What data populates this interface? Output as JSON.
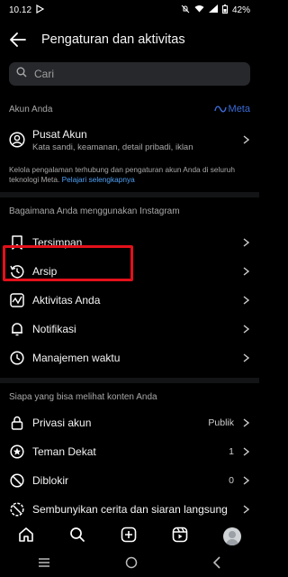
{
  "status": {
    "time": "10.12",
    "battery": "42%"
  },
  "header": {
    "title": "Pengaturan dan aktivitas"
  },
  "search": {
    "placeholder": "Cari"
  },
  "account": {
    "section_title": "Akun Anda",
    "meta_logo": "Meta",
    "item_label": "Pusat Akun",
    "item_sub": "Kata sandi, keamanan, detail pribadi, iklan",
    "note": "Kelola pengalaman terhubung dan pengaturan akun Anda di seluruh teknologi Meta.",
    "note_link": "Pelajari selengkapnya"
  },
  "usage": {
    "section_title": "Bagaimana Anda menggunakan Instagram",
    "items": [
      {
        "label": "Tersimpan",
        "icon": "bookmark-icon"
      },
      {
        "label": "Arsip",
        "icon": "archive-history-icon"
      },
      {
        "label": "Aktivitas Anda",
        "icon": "activity-icon"
      },
      {
        "label": "Notifikasi",
        "icon": "bell-icon"
      },
      {
        "label": "Manajemen waktu",
        "icon": "clock-icon"
      }
    ]
  },
  "visibility": {
    "section_title": "Siapa yang bisa melihat konten Anda",
    "items": [
      {
        "label": "Privasi akun",
        "value": "Publik",
        "icon": "lock-icon"
      },
      {
        "label": "Teman Dekat",
        "value": "1",
        "icon": "star-circle-icon"
      },
      {
        "label": "Diblokir",
        "value": "0",
        "icon": "block-icon"
      },
      {
        "label": "Sembunyikan cerita dan siaran langsung",
        "value": "",
        "icon": "hide-story-icon"
      }
    ]
  },
  "colors": {
    "highlight": "#e3101a",
    "link": "#4ea1f5",
    "meta_logo": "#3b6bd6"
  }
}
